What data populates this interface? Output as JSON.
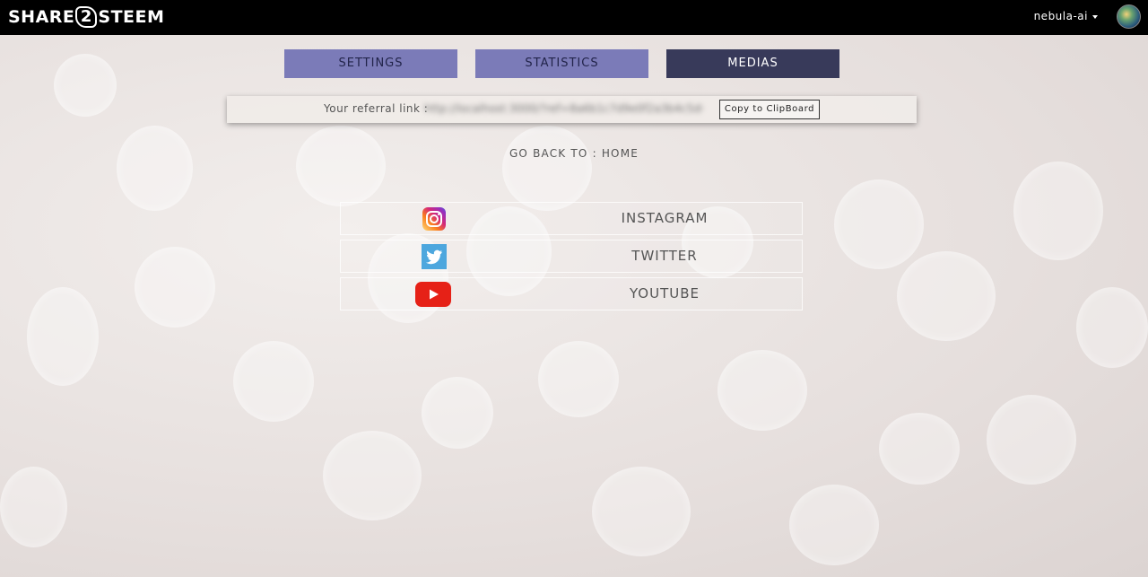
{
  "header": {
    "logo_text_left": "SHARE",
    "logo_text_mid": "2",
    "logo_text_right": "STEEM",
    "username": "nebula-ai"
  },
  "tabs": [
    {
      "label": "SETTINGS"
    },
    {
      "label": "STATISTICS"
    },
    {
      "label": "MEDIAS"
    }
  ],
  "referral": {
    "label": "Your referral link :",
    "link": "http://localhost:3000/?ref=8a6b1c7d9e0f2a3b4c5d6e7f",
    "copy_label": "Copy to ClipBoard"
  },
  "nav": {
    "go_back": "GO BACK TO : HOME"
  },
  "medias": [
    {
      "label": "INSTAGRAM",
      "icon": "instagram-icon"
    },
    {
      "label": "TWITTER",
      "icon": "twitter-icon"
    },
    {
      "label": "YOUTUBE",
      "icon": "youtube-icon"
    }
  ],
  "colors": {
    "tab_inactive": "#7b7bb8",
    "tab_active": "#383a5a",
    "topbar": "#000000"
  }
}
